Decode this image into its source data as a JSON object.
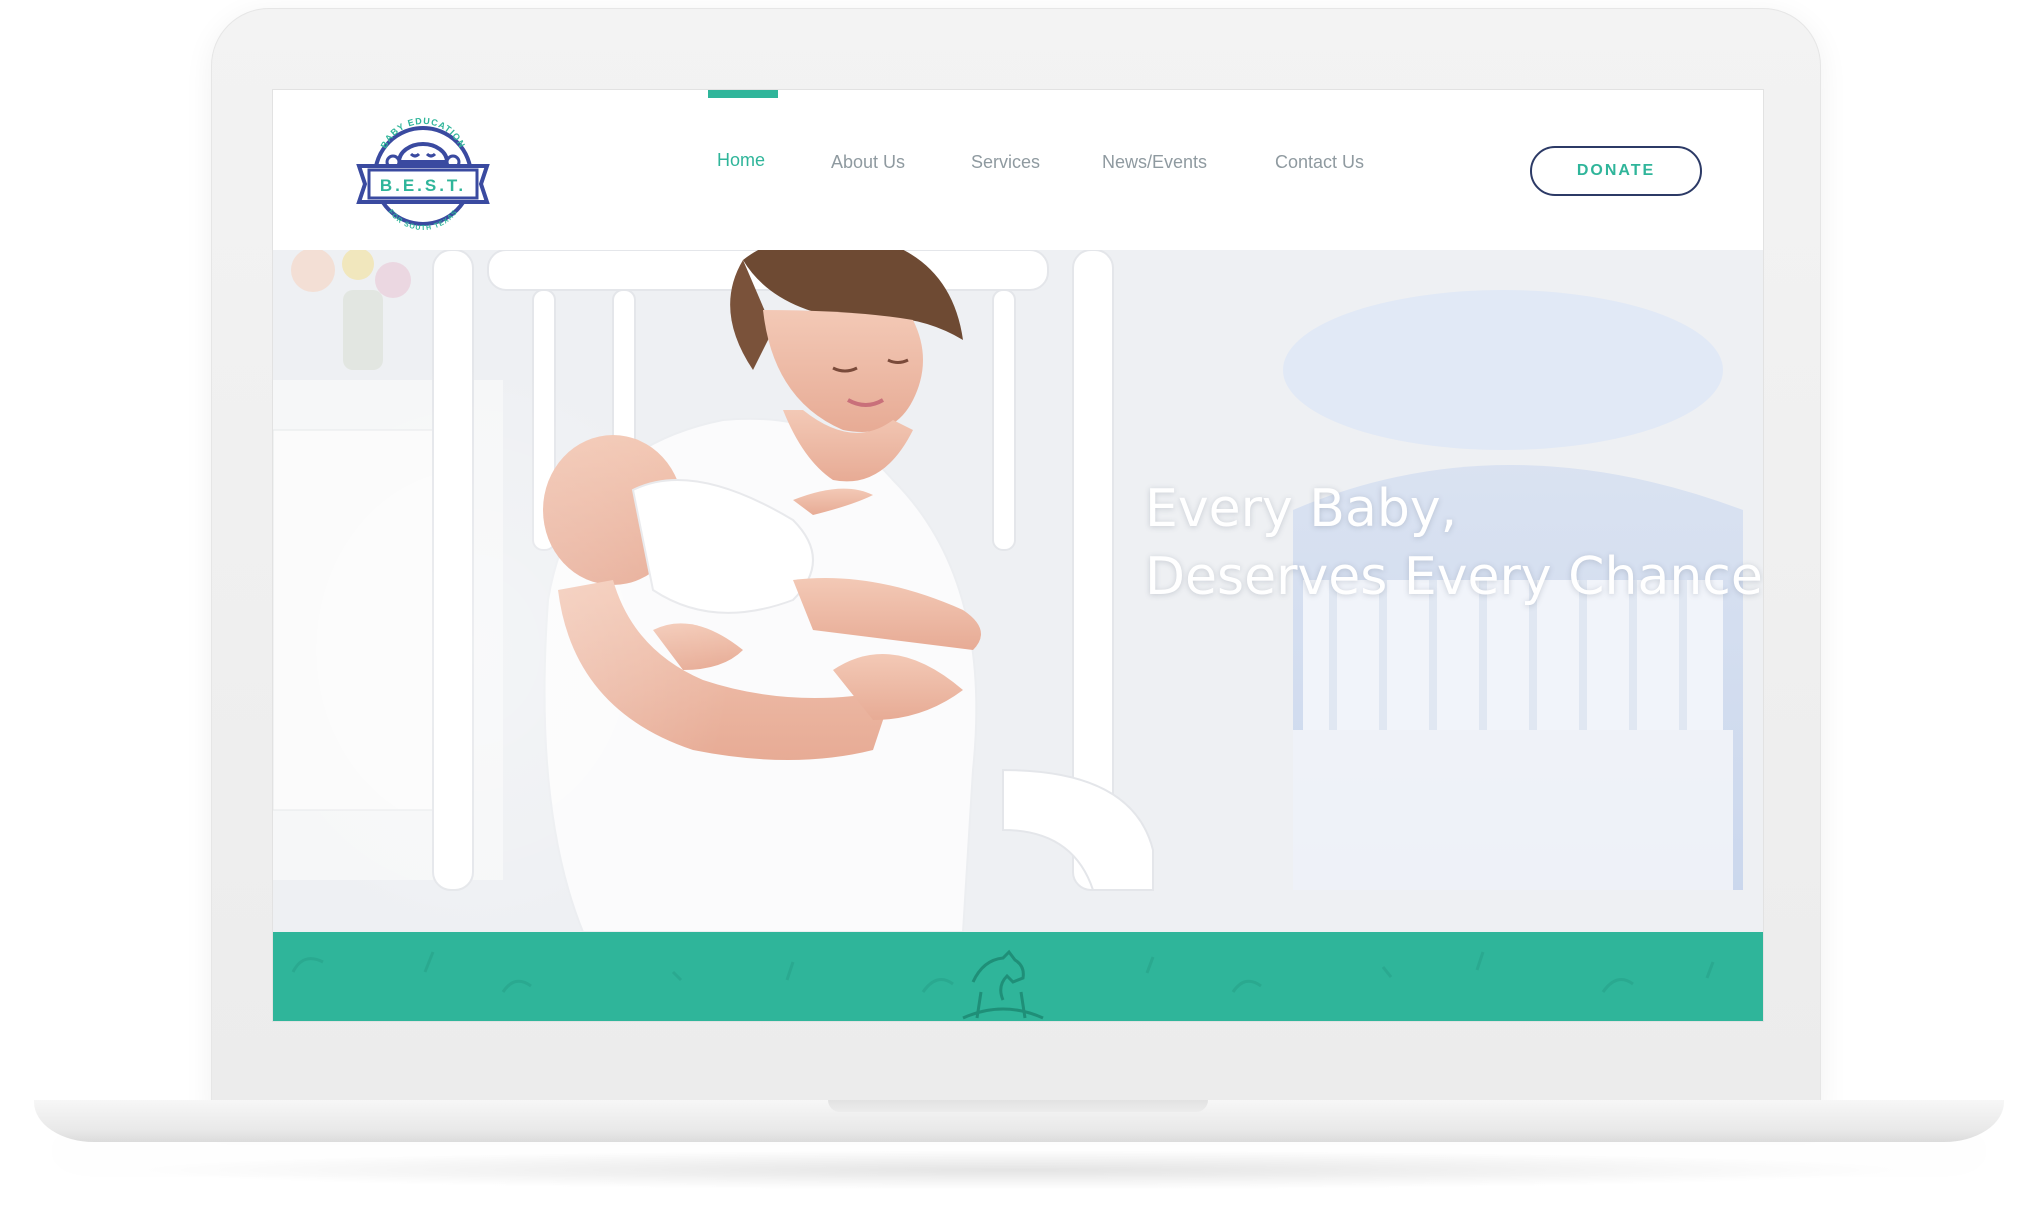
{
  "logo": {
    "arc_top": "BABY EDUCATION",
    "initials": "B.E.S.T.",
    "arc_bottom": "FOR SOUTH TEXAS"
  },
  "nav": {
    "items": [
      {
        "label": "Home",
        "active": true
      },
      {
        "label": "About Us",
        "active": false
      },
      {
        "label": "Services",
        "active": false
      },
      {
        "label": "News/Events",
        "active": false
      },
      {
        "label": "Contact Us",
        "active": false
      }
    ],
    "donate_label": "DONATE"
  },
  "hero": {
    "title_line1": "Every Baby,",
    "title_line2": "Deserves Every Chance"
  },
  "colors": {
    "accent": "#2fb59a",
    "navy": "#2c3a66",
    "nav_text": "#8f9aa0"
  },
  "icons": {
    "band_center": "rocking-horse-icon"
  }
}
